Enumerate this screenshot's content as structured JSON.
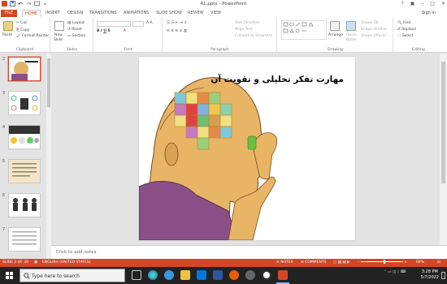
{
  "window": {
    "title": "41.pptx - PowerPoint",
    "sign_in": "Sign in"
  },
  "tabs": [
    "FILE",
    "HOME",
    "INSERT",
    "DESIGN",
    "TRANSITIONS",
    "ANIMATIONS",
    "SLIDE SHOW",
    "REVIEW",
    "VIEW"
  ],
  "ribbon": {
    "clipboard": {
      "label": "Clipboard",
      "paste": "Paste",
      "cut": "Cut",
      "copy": "Copy",
      "format_painter": "Format Painter"
    },
    "slides": {
      "label": "Slides",
      "new_slide": "New",
      "new_slide2": "Slide",
      "layout": "Layout",
      "reset": "Reset",
      "section": "Section"
    },
    "font": {
      "label": "Font"
    },
    "paragraph": {
      "label": "Paragraph",
      "text_direction": "Text Direction",
      "align_text": "Align Text",
      "convert_smartart": "Convert to SmartArt"
    },
    "drawing": {
      "label": "Drawing",
      "arrange": "Arrange",
      "quick_styles": "Quick",
      "quick_styles2": "Styles",
      "shape_fill": "Shape Fill",
      "shape_outline": "Shape Outline",
      "shape_effects": "Shape Effects"
    },
    "editing": {
      "label": "Editing",
      "find": "Find",
      "replace": "Replace",
      "select": "Select"
    }
  },
  "thumbnails": [
    "2",
    "3",
    "4",
    "5",
    "6",
    "7"
  ],
  "slide": {
    "title": "مهارت تفکر تحلیلی و تقویت آن"
  },
  "notes": {
    "placeholder": "Click to add notes"
  },
  "status": {
    "slide": "SLIDE 2 OF 30",
    "language": "ENGLISH (UNITED STATES)",
    "notes": "NOTES",
    "comments": "COMMENTS",
    "zoom": "69%"
  },
  "taskbar": {
    "search": "Type here to search",
    "time": "3:28 PM",
    "date": "5/7/2022"
  },
  "colors": {
    "accent": "#d24726"
  }
}
